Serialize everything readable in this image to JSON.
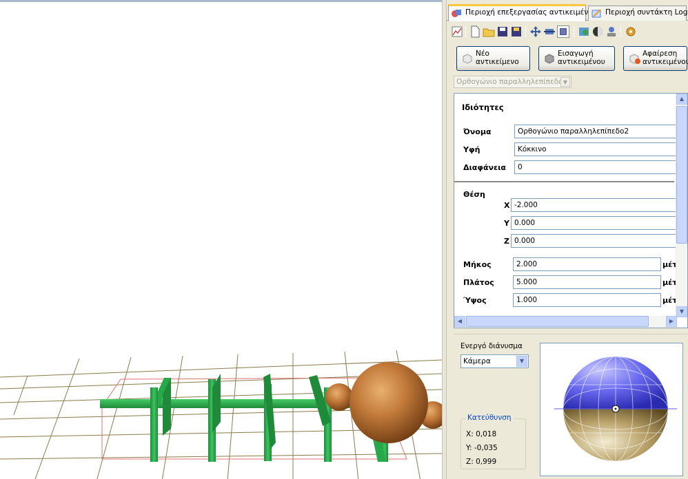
{
  "tabs": [
    {
      "label": "Περιοχή επεξεργασίας αντικειμένων",
      "active": true
    },
    {
      "label": "Περιοχή συντάκτη Logo",
      "active": false
    }
  ],
  "toolbar": {
    "icons": [
      "chart-icon",
      "new-file-icon",
      "open-folder-icon",
      "save-icon",
      "save-all-icon",
      "move-icon",
      "scale-icon",
      "view-icon",
      "texture-icon",
      "sphere-icon",
      "user-icon",
      "settings-icon"
    ]
  },
  "buttons": {
    "new_object": "Νέο\nαντικείμενο",
    "import_object": "Εισαγωγή\nαντικειμένου",
    "remove_object": "Αφαίρεση\nαντικειμένου"
  },
  "object_select": {
    "value": "Ορθογώνιο παραλληλεπίπεδο"
  },
  "properties": {
    "title": "Ιδιότητες",
    "name_label": "Όνομα",
    "name_value": "Ορθογώνιο παραλληλεπίπεδο2",
    "texture_label": "Υφή",
    "texture_value": "Κόκκινο",
    "transparency_label": "Διαφάνεια",
    "transparency_value": "0",
    "position_label": "Θέση",
    "x_label": "X",
    "x_value": "-2.000",
    "y_label": "Y",
    "y_value": "0.000",
    "z_label": "Z",
    "z_value": "0.000",
    "length_label": "Μήκος",
    "length_value": "2.000",
    "width_label": "Πλάτος",
    "width_value": "5.000",
    "height_label": "Ύψος",
    "height_value": "1.000",
    "unit": "μέτ"
  },
  "active_vector": {
    "label": "Ενεργό διάνυσμα",
    "value": "Κάμερα"
  },
  "direction": {
    "title": "Κατεύθυνση",
    "x": "X: 0,018",
    "y": "Y: -0,035",
    "z": "Z: 0,999"
  },
  "colors": {
    "tab_highlight": "#ffc83c",
    "field_border": "#7f9db9",
    "panel_bg": "#ece9d8",
    "green_bars": "#27a84a",
    "grid_line": "#8a7a4a",
    "selection_box": "#e07070",
    "sphere_top": "#5a5ae0",
    "sphere_bottom": "#b8a060"
  }
}
